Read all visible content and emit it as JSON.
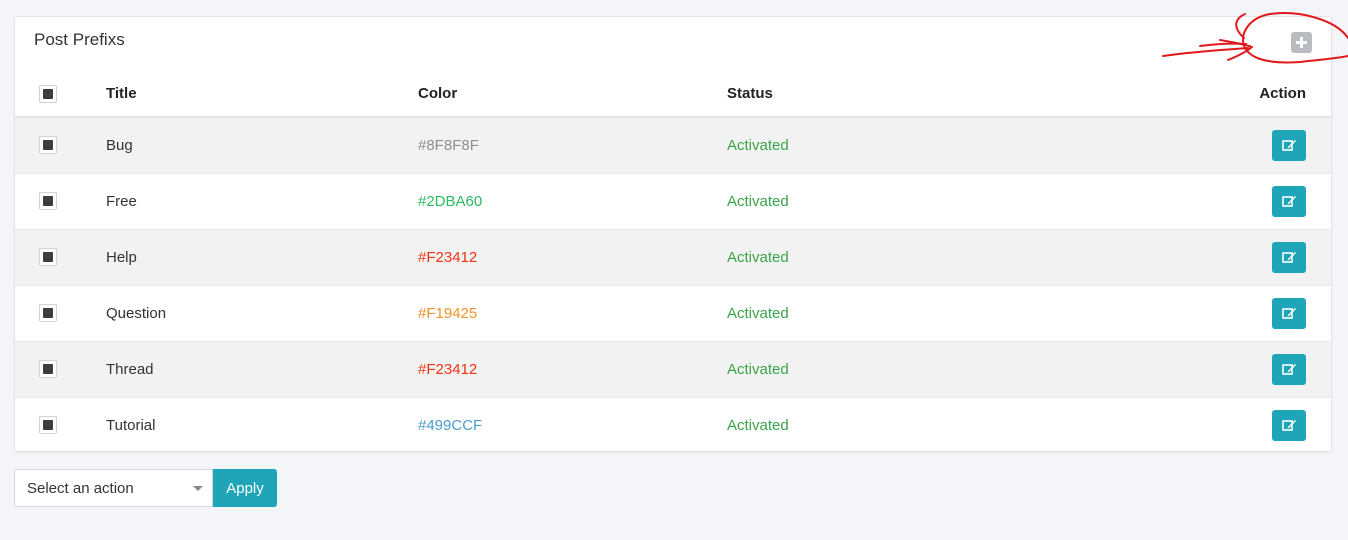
{
  "panel": {
    "title": "Post Prefixs"
  },
  "table": {
    "headers": {
      "title": "Title",
      "color": "Color",
      "status": "Status",
      "action": "Action"
    },
    "rows": [
      {
        "title": "Bug",
        "color_code": "#8F8F8F",
        "color_hex": "#8f8f8f",
        "status": "Activated"
      },
      {
        "title": "Free",
        "color_code": "#2DBA60",
        "color_hex": "#2dba60",
        "status": "Activated"
      },
      {
        "title": "Help",
        "color_code": "#F23412",
        "color_hex": "#f23412",
        "status": "Activated"
      },
      {
        "title": "Question",
        "color_code": "#F19425",
        "color_hex": "#f19425",
        "status": "Activated"
      },
      {
        "title": "Thread",
        "color_code": "#F23412",
        "color_hex": "#f23412",
        "status": "Activated"
      },
      {
        "title": "Tutorial",
        "color_code": "#499CCF",
        "color_hex": "#499ccf",
        "status": "Activated"
      }
    ]
  },
  "footer": {
    "select_placeholder": "Select an action",
    "apply_label": "Apply"
  },
  "icons": {
    "add": "plus-square-icon",
    "edit": "edit-icon",
    "caret": "caret-down-icon"
  },
  "colors": {
    "accent": "#1ea5b8",
    "status_active": "#3aa34a",
    "annotation": "#e0191c"
  }
}
